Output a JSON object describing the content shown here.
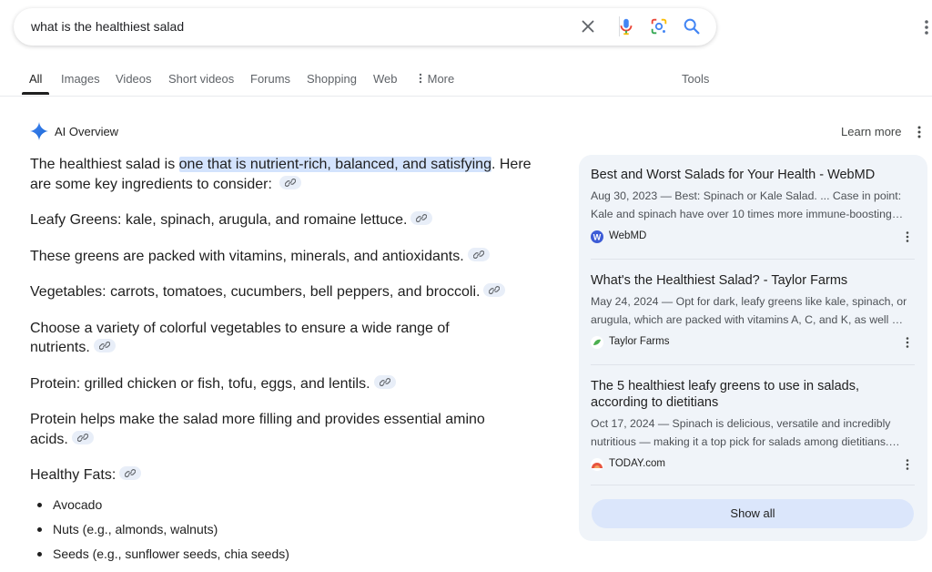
{
  "search": {
    "query": "what is the healthiest salad"
  },
  "tabs": [
    {
      "label": "All",
      "active": true
    },
    {
      "label": "Images"
    },
    {
      "label": "Videos"
    },
    {
      "label": "Short videos"
    },
    {
      "label": "Forums"
    },
    {
      "label": "Shopping"
    },
    {
      "label": "Web"
    },
    {
      "label": "More"
    }
  ],
  "tools_label": "Tools",
  "ai_overview": {
    "title": "AI Overview",
    "learn_more": "Learn more",
    "intro_before": "The healthiest salad is ",
    "intro_highlight": "one that is nutrient-rich, balanced, and satisfying",
    "intro_after": ". Here are some key ingredients to consider:",
    "paragraphs": [
      "Leafy Greens: kale, spinach, arugula, and romaine lettuce.",
      "These greens are packed with vitamins, minerals, and antioxidants.",
      "Vegetables: carrots, tomatoes, cucumbers, bell peppers, and broccoli.",
      "Choose a variety of colorful vegetables to ensure a wide range of nutrients.",
      "Protein: grilled chicken or fish, tofu, eggs, and lentils.",
      "Protein helps make the salad more filling and provides essential amino acids.",
      "Healthy Fats:"
    ],
    "bullets": [
      "Avocado",
      "Nuts (e.g., almonds, walnuts)",
      "Seeds (e.g., sunflower seeds, chia seeds)"
    ]
  },
  "sources": [
    {
      "title": "Best and Worst Salads for Your Health - WebMD",
      "snippet_line1": "Aug 30, 2023 — Best: Spinach or Kale Salad. ... Case in point:",
      "snippet_line2": "Kale and spinach have over 10 times more immune-boosting…",
      "site": "WebMD",
      "favicon_color": "#3c5bd6"
    },
    {
      "title": "What's the Healthiest Salad? - Taylor Farms",
      "snippet_line1": "May 24, 2024 — Opt for dark, leafy greens like kale, spinach, or",
      "snippet_line2": "arugula, which are packed with vitamins A, C, and K, as well …",
      "site": "Taylor Farms",
      "favicon_color": "#4caf50"
    },
    {
      "title": "The 5 healthiest leafy greens to use in salads, according to dietitians",
      "snippet_line1": "Oct 17, 2024 — Spinach is delicious, versatile and incredibly",
      "snippet_line2": "nutritious — making it a top pick for salads among dietitians.…",
      "site": "TODAY.com",
      "favicon_color": "#e8553f"
    }
  ],
  "show_all": "Show all",
  "colors": {
    "highlight": "#d3e3fd",
    "source_panel": "#f0f4f9",
    "show_all_bg": "#dbe6fb"
  }
}
